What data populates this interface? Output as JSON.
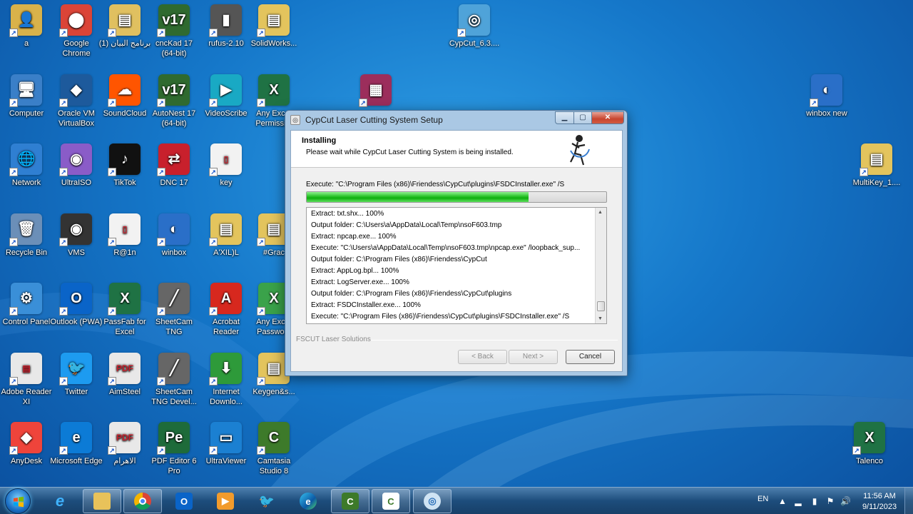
{
  "desktop": {
    "icons": [
      {
        "label": "a",
        "glyph": "👤",
        "color": "#d9b24a"
      },
      {
        "label": "Google Chrome",
        "glyph": "⬤",
        "color": "#db4437"
      },
      {
        "label": "برنامج البيان (1)",
        "glyph": "▤",
        "color": "#e0c060"
      },
      {
        "label": "cncKad 17 (64-bit)",
        "glyph": "v17",
        "color": "#2f6a2f"
      },
      {
        "label": "rufus-2.10",
        "glyph": "▮",
        "color": "#555"
      },
      {
        "label": "SolidWorks...",
        "glyph": "▤",
        "color": "#e3c45d"
      },
      {
        "label": "CypCut_6.3....",
        "glyph": "◎",
        "color": "#4fa3d9"
      },
      {
        "label": "Computer",
        "glyph": "🖥",
        "color": "#3a7fc8"
      },
      {
        "label": "Oracle VM VirtualBox",
        "glyph": "◆",
        "color": "#1d5a9c"
      },
      {
        "label": "SoundCloud",
        "glyph": "☁",
        "color": "#ff5500"
      },
      {
        "label": "AutoNest 17 (64-bit)",
        "glyph": "v17",
        "color": "#2f6a2f"
      },
      {
        "label": "VideoScribe",
        "glyph": "▶",
        "color": "#19a9c4"
      },
      {
        "label": "Any Exc... Permissi...",
        "glyph": "X",
        "color": "#1f7244"
      },
      {
        "label": "winbox new",
        "glyph": "◐",
        "color": "#2a6fc8"
      },
      {
        "label": "Network",
        "glyph": "🌐",
        "color": "#2f7fd2"
      },
      {
        "label": "UltraISO",
        "glyph": "◉",
        "color": "#8a5cc8"
      },
      {
        "label": "TikTok",
        "glyph": "♪",
        "color": "#111"
      },
      {
        "label": "DNC 17",
        "glyph": "⇄",
        "color": "#c8202c"
      },
      {
        "label": "key",
        "glyph": "▯",
        "color": "#f2f2f2"
      },
      {
        "label": "MultiKey_1....",
        "glyph": "▤",
        "color": "#e3c45d"
      },
      {
        "label": "Recycle Bin",
        "glyph": "🗑",
        "color": "#6b8fb8"
      },
      {
        "label": "VMS",
        "glyph": "◉",
        "color": "#333"
      },
      {
        "label": "R@1n",
        "glyph": "▯",
        "color": "#f2f2f2"
      },
      {
        "label": "winbox",
        "glyph": "◐",
        "color": "#2a6fc8"
      },
      {
        "label": "A'XIL)L",
        "glyph": "▤",
        "color": "#e3c45d"
      },
      {
        "label": "#Grac",
        "glyph": "▤",
        "color": "#e3c45d"
      },
      {
        "label": "Control Panel",
        "glyph": "⚙",
        "color": "#3a8fd8"
      },
      {
        "label": "Outlook (PWA)",
        "glyph": "O",
        "color": "#0a64c8"
      },
      {
        "label": "PassFab for Excel",
        "glyph": "X",
        "color": "#1f7244"
      },
      {
        "label": "SheetCam TNG",
        "glyph": "╱",
        "color": "#666"
      },
      {
        "label": "Acrobat Reader",
        "glyph": "A",
        "color": "#d7281e"
      },
      {
        "label": "Any Exc... Passwo...",
        "glyph": "X",
        "color": "#3aa24a"
      },
      {
        "label": "Adobe Reader XI",
        "glyph": "▤",
        "color": "#e8e8e8"
      },
      {
        "label": "Twitter",
        "glyph": "🐦",
        "color": "#1d9bf0"
      },
      {
        "label": "AimSteel",
        "glyph": "PDF",
        "color": "#e8e8e8"
      },
      {
        "label": "SheetCam TNG Devel...",
        "glyph": "╱",
        "color": "#666"
      },
      {
        "label": "Internet Downlo...",
        "glyph": "⬇",
        "color": "#2e9a3a"
      },
      {
        "label": "Keygen&s...",
        "glyph": "▤",
        "color": "#e3c45d"
      },
      {
        "label": "AnyDesk",
        "glyph": "◆",
        "color": "#ef443b"
      },
      {
        "label": "Microsoft Edge",
        "glyph": "e",
        "color": "#0c7bd6"
      },
      {
        "label": "الاهرام",
        "glyph": "PDF",
        "color": "#e8e8e8"
      },
      {
        "label": "PDF Editor 6 Pro",
        "glyph": "Pe",
        "color": "#1e6b3a"
      },
      {
        "label": "UltraViewer",
        "glyph": "▭",
        "color": "#1b80d2"
      },
      {
        "label": "Camtasia Studio 8",
        "glyph": "C",
        "color": "#3d7a2a"
      },
      {
        "label": "Talenco",
        "glyph": "X",
        "color": "#1f7244"
      },
      {
        "label": "",
        "glyph": "▦",
        "color": "#9c2e5c"
      }
    ]
  },
  "dialog": {
    "title": "CypCut Laser Cutting System Setup",
    "header_title": "Installing",
    "header_subtitle": "Please wait while CypCut Laser Cutting System is being installed.",
    "execute_line": "Execute: \"C:\\Program Files (x86)\\Friendess\\CypCut\\plugins\\FSDCInstaller.exe\" /S",
    "progress_fraction": 0.74,
    "log": [
      "Extract: txt.shx... 100%",
      "Output folder: C:\\Users\\a\\AppData\\Local\\Temp\\nsoF603.tmp",
      "Extract: npcap.exe... 100%",
      "Execute: \"C:\\Users\\a\\AppData\\Local\\Temp\\nsoF603.tmp\\npcap.exe\" /loopback_sup...",
      "Output folder: C:\\Program Files (x86)\\Friendess\\CypCut",
      "Extract: AppLog.bpl... 100%",
      "Extract: LogServer.exe... 100%",
      "Output folder: C:\\Program Files (x86)\\Friendess\\CypCut\\plugins",
      "Extract: FSDCInstaller.exe... 100%",
      "Execute: \"C:\\Program Files (x86)\\Friendess\\CypCut\\plugins\\FSDCInstaller.exe\" /S"
    ],
    "brand": "FSCUT Laser Solutions",
    "back_label": "< Back",
    "next_label": "Next >",
    "cancel_label": "Cancel"
  },
  "taskbar": {
    "language": "EN",
    "time": "11:56 AM",
    "date": "9/11/2023"
  }
}
